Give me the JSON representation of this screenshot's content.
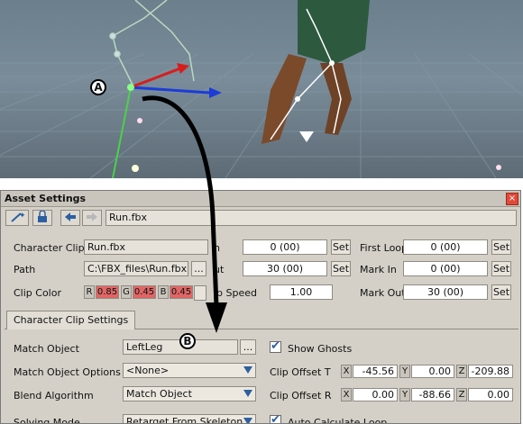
{
  "callouts": {
    "a": "A",
    "b": "B"
  },
  "panel": {
    "title": "Asset Settings",
    "close_glyph": "×",
    "toolbar": {
      "icons": [
        "wand-icon",
        "lock-icon",
        "back-arrow-icon",
        "forward-arrow-icon"
      ],
      "filename": "Run.fbx"
    },
    "rows": {
      "character_clip": {
        "label": "Character Clip",
        "value": "Run.fbx"
      },
      "path": {
        "label": "Path",
        "value": "C:\\FBX_files\\Run.fbx",
        "browse": "..."
      },
      "clip_color": {
        "label": "Clip Color",
        "r_label": "R",
        "r": "0.85",
        "g_label": "G",
        "g": "0.45",
        "b_label": "B",
        "b": "0.45"
      },
      "start": {
        "label": "n",
        "value": "0 (00)",
        "set": "Set"
      },
      "stop": {
        "label": "ut",
        "value": "30 (00)",
        "set": "Set"
      },
      "speed": {
        "label": "ip Speed",
        "value": "1.00"
      },
      "first_loop": {
        "label": "First Loop",
        "value": "0 (00)",
        "set": "Set"
      },
      "mark_in": {
        "label": "Mark In",
        "value": "0 (00)",
        "set": "Set"
      },
      "mark_out": {
        "label": "Mark Out",
        "value": "30 (00)",
        "set": "Set"
      }
    },
    "tab": "Character Clip Settings",
    "settings": {
      "match_object": {
        "label": "Match Object",
        "value": "LeftLeg",
        "browse": "..."
      },
      "show_ghosts": "Show Ghosts",
      "match_options": {
        "label": "Match Object Options",
        "value": "<None>"
      },
      "offset_t": {
        "label": "Clip Offset T",
        "x": "-45.56",
        "y": "0.00",
        "z": "-209.88"
      },
      "blend": {
        "label": "Blend Algorithm",
        "value": "Match Object"
      },
      "offset_r": {
        "label": "Clip Offset R",
        "x": "0.00",
        "y": "-88.66",
        "z": "0.00"
      },
      "solving": {
        "label": "Solving Mode",
        "value": "Retarget From Skeleton"
      },
      "auto_loop": "Auto Calculate Loop"
    },
    "axes": {
      "x": "X",
      "y": "Y",
      "z": "Z"
    }
  }
}
